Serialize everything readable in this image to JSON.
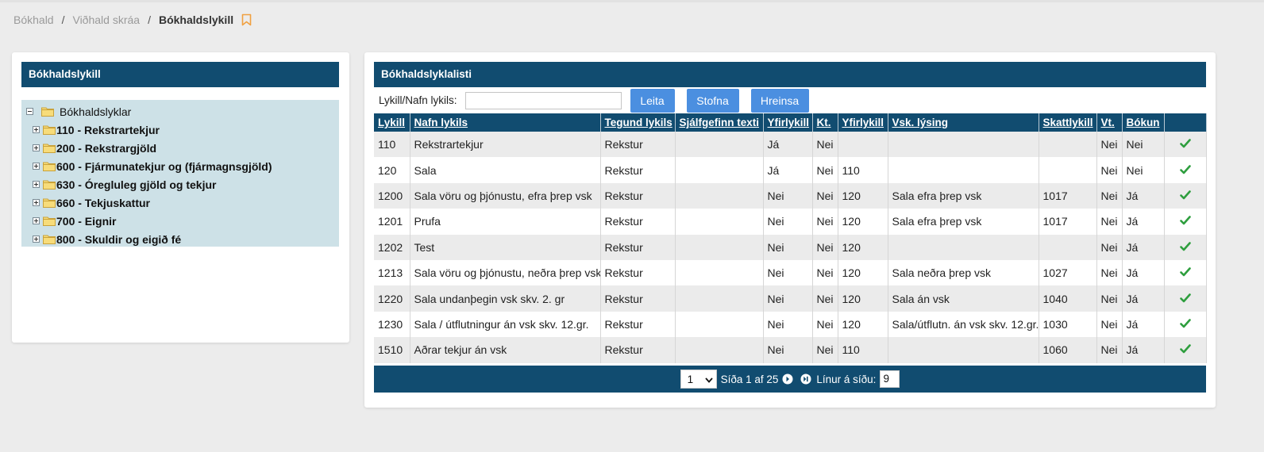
{
  "breadcrumb": {
    "items": [
      "Bókhald",
      "Viðhald skráa"
    ],
    "separator": "/",
    "current": "Bókhaldslykill",
    "bookmark_icon": "bookmark-icon"
  },
  "left_panel": {
    "title": "Bókhaldslykill",
    "tree": {
      "root": "Bókhaldslyklar",
      "items": [
        "110 - Rekstrartekjur",
        "200 - Rekstrargjöld",
        "600 - Fjármunatekjur og (fjármagnsgjöld)",
        "630 - Óregluleg gjöld og tekjur",
        "660 - Tekjuskattur",
        "700 - Eignir",
        "800 - Skuldir og eigið fé"
      ]
    }
  },
  "right_panel": {
    "title": "Bókhaldslyklalisti",
    "search": {
      "label": "Lykill/Nafn lykils:",
      "value": "",
      "placeholder": ""
    },
    "buttons": {
      "search": "Leita",
      "create": "Stofna",
      "clear": "Hreinsa"
    },
    "table": {
      "headers": [
        "Lykill",
        "Nafn lykils",
        "Tegund lykils",
        "Sjálfgefinn texti",
        "Yfirlykill",
        "Kt.",
        "Yfirlykill",
        "Vsk. lýsing",
        "Skattlykill",
        "Vt.",
        "Bókun",
        ""
      ],
      "rows": [
        [
          "110",
          "Rekstrartekjur",
          "Rekstur",
          "",
          "Já",
          "Nei",
          "",
          "",
          "",
          "Nei",
          "Nei"
        ],
        [
          "120",
          "Sala",
          "Rekstur",
          "",
          "Já",
          "Nei",
          "110",
          "",
          "",
          "Nei",
          "Nei"
        ],
        [
          "1200",
          "Sala vöru og þjónustu, efra þrep vsk",
          "Rekstur",
          "",
          "Nei",
          "Nei",
          "120",
          "Sala efra þrep vsk",
          "1017",
          "Nei",
          "Já"
        ],
        [
          "1201",
          "Prufa",
          "Rekstur",
          "",
          "Nei",
          "Nei",
          "120",
          "Sala efra þrep vsk",
          "1017",
          "Nei",
          "Já"
        ],
        [
          "1202",
          "Test",
          "Rekstur",
          "",
          "Nei",
          "Nei",
          "120",
          "",
          "",
          "Nei",
          "Já"
        ],
        [
          "1213",
          "Sala vöru og þjónustu, neðra þrep vsk",
          "Rekstur",
          "",
          "Nei",
          "Nei",
          "120",
          "Sala neðra þrep vsk",
          "1027",
          "Nei",
          "Já"
        ],
        [
          "1220",
          "Sala undanþegin vsk skv. 2. gr",
          "Rekstur",
          "",
          "Nei",
          "Nei",
          "120",
          "Sala án vsk",
          "1040",
          "Nei",
          "Já"
        ],
        [
          "1230",
          "Sala / útflutningur án vsk skv. 12.gr.",
          "Rekstur",
          "",
          "Nei",
          "Nei",
          "120",
          "Sala/útflutn. án vsk skv. 12.gr.",
          "1030",
          "Nei",
          "Já"
        ],
        [
          "1510",
          "Aðrar tekjur án vsk",
          "Rekstur",
          "",
          "Nei",
          "Nei",
          "110",
          "",
          "1060",
          "Nei",
          "Já"
        ]
      ],
      "row_action_icon": "check-icon",
      "check_color": "#2e9e3e"
    },
    "pager": {
      "page_select": "1",
      "page_text": "Síða 1 af 25",
      "rows_label": "Línur á síðu:",
      "rows_value": "9",
      "next_icon": "next-page-icon",
      "last_icon": "last-page-icon"
    }
  },
  "colors": {
    "header": "#114c70",
    "button": "#4b8fe0",
    "tree_bg": "#cde1e7",
    "bookmark": "#f0a040"
  }
}
